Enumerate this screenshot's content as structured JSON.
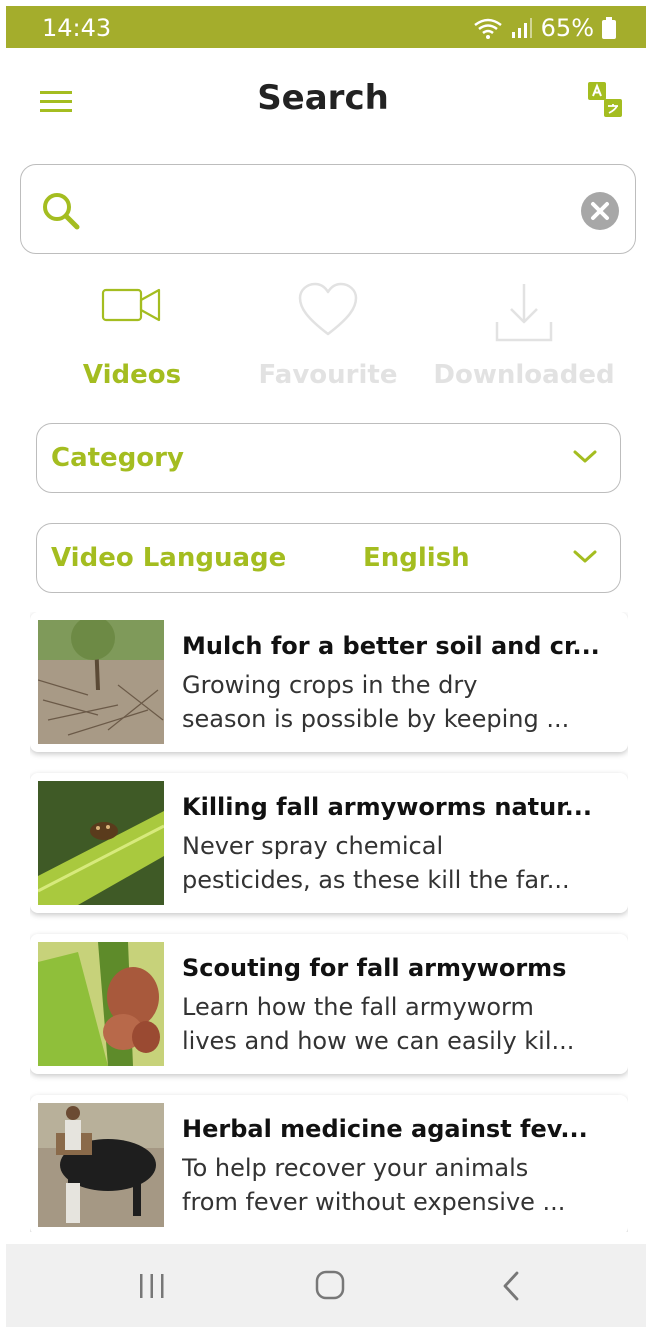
{
  "status": {
    "time": "14:43",
    "battery": "65%"
  },
  "header": {
    "title": "Search"
  },
  "search": {
    "placeholder": "",
    "value": ""
  },
  "tabs": [
    {
      "label": "Videos",
      "active": true
    },
    {
      "label": "Favourite",
      "active": false
    },
    {
      "label": "Downloaded",
      "active": false
    }
  ],
  "filters": {
    "category": {
      "label": "Category"
    },
    "language": {
      "label": "Video Language",
      "value": "English"
    }
  },
  "videos": [
    {
      "title": "Mulch for a better soil and cr...",
      "desc_line1": "Growing crops in the dry",
      "desc_line2": "season is possible by keeping ..."
    },
    {
      "title": "Killing fall armyworms natur...",
      "desc_line1": "Never spray chemical",
      "desc_line2": "pesticides, as these kill the far..."
    },
    {
      "title": "Scouting for fall armyworms",
      "desc_line1": "Learn how the fall armyworm",
      "desc_line2": "lives and how we can easily kil..."
    },
    {
      "title": "Herbal medicine against fev...",
      "desc_line1": "To help recover your animals",
      "desc_line2": "from fever without expensive ..."
    }
  ],
  "colors": {
    "accent": "#a4bd20",
    "statusbar": "#a4ad2c",
    "inactive": "#e2e2e2"
  }
}
